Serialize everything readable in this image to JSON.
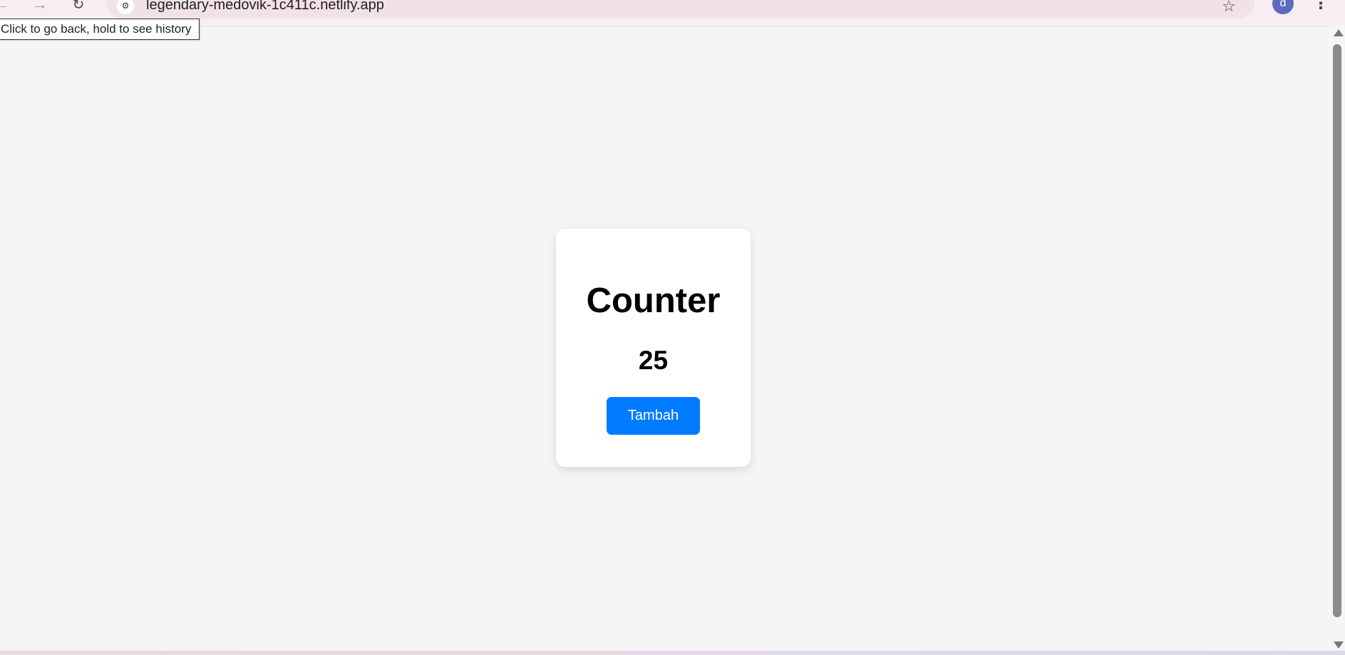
{
  "browser": {
    "back_icon": "←",
    "forward_icon": "→",
    "reload_icon": "↻",
    "site_info_icon": "⚙",
    "url": "legendary-medovik-1c411c.netlify.app",
    "star_icon": "☆",
    "avatar_letter": "d",
    "menu_icon": "⋮",
    "tooltip": "Click to go back, hold to see history"
  },
  "counter": {
    "title": "Counter",
    "value": "25",
    "button_label": "Tambah"
  },
  "colors": {
    "page_background": "#f5f5f5",
    "card_background": "#ffffff",
    "button_background": "#007bff",
    "button_text": "#ffffff",
    "avatar_background": "#5c6bc0"
  }
}
